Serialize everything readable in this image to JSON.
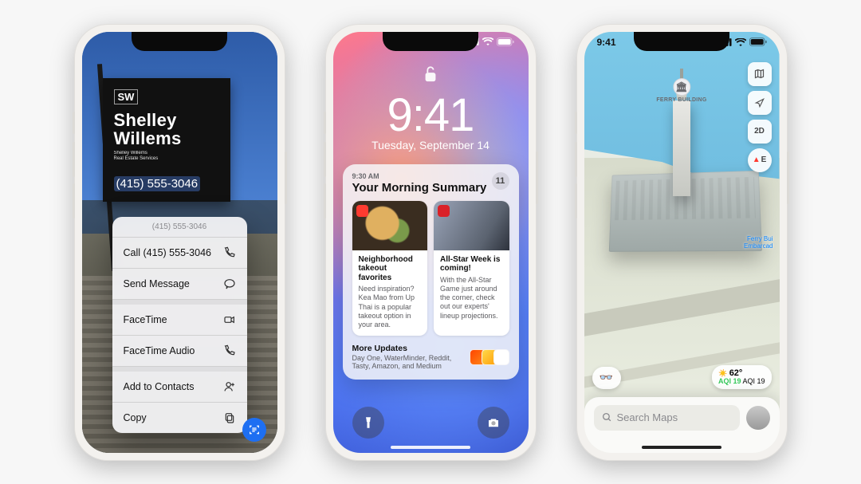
{
  "phone1": {
    "sign": {
      "logo": "SW",
      "name_line1": "Shelley",
      "name_line2": "Willems",
      "sub_line1": "Shelley Willems",
      "sub_line2": "Real Estate Services",
      "phone": "(415) 555-3046"
    },
    "menu": {
      "header": "(415) 555-3046",
      "items": [
        {
          "label": "Call (415) 555-3046",
          "icon": "phone-icon"
        },
        {
          "label": "Send Message",
          "icon": "message-icon"
        },
        {
          "label": "FaceTime",
          "icon": "facetime-video-icon"
        },
        {
          "label": "FaceTime Audio",
          "icon": "facetime-audio-icon"
        },
        {
          "label": "Add to Contacts",
          "icon": "add-contact-icon"
        },
        {
          "label": "Copy",
          "icon": "copy-icon"
        }
      ]
    }
  },
  "phone2": {
    "status_time": "",
    "lock_time": "9:41",
    "lock_date": "Tuesday, September 14",
    "summary": {
      "time": "9:30 AM",
      "title": "Your Morning Summary",
      "count": "11",
      "cards": [
        {
          "title": "Neighborhood takeout favorites",
          "text": "Need inspiration? Kea Mao from Up Thai is a popular takeout option in your area."
        },
        {
          "title": "All-Star Week is coming!",
          "text": "With the All-Star Game just around the corner, check out our experts' lineup projections."
        }
      ],
      "more_title": "More Updates",
      "more_text": "Day One, WaterMinder, Reddit, Tasty, Amazon, and Medium"
    }
  },
  "phone3": {
    "status_time": "9:41",
    "controls": {
      "mode2d": "2D",
      "compass": "E"
    },
    "poi_name": "FERRY BUILDING",
    "transit_line1": "Ferry Bui",
    "transit_line2": "Embarcad",
    "weather": {
      "temp": "62°",
      "aqi": "AQI 19"
    },
    "search_placeholder": "Search Maps"
  }
}
